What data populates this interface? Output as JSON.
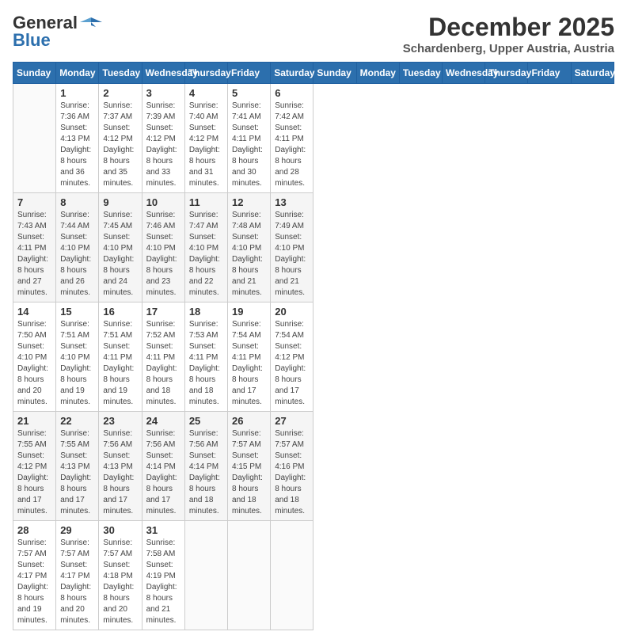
{
  "header": {
    "logo_general": "General",
    "logo_blue": "Blue",
    "month_title": "December 2025",
    "subtitle": "Schardenberg, Upper Austria, Austria"
  },
  "calendar": {
    "days_of_week": [
      "Sunday",
      "Monday",
      "Tuesday",
      "Wednesday",
      "Thursday",
      "Friday",
      "Saturday"
    ],
    "weeks": [
      [
        {
          "day": "",
          "sunrise": "",
          "sunset": "",
          "daylight": ""
        },
        {
          "day": "1",
          "sunrise": "Sunrise: 7:36 AM",
          "sunset": "Sunset: 4:13 PM",
          "daylight": "Daylight: 8 hours and 36 minutes."
        },
        {
          "day": "2",
          "sunrise": "Sunrise: 7:37 AM",
          "sunset": "Sunset: 4:12 PM",
          "daylight": "Daylight: 8 hours and 35 minutes."
        },
        {
          "day": "3",
          "sunrise": "Sunrise: 7:39 AM",
          "sunset": "Sunset: 4:12 PM",
          "daylight": "Daylight: 8 hours and 33 minutes."
        },
        {
          "day": "4",
          "sunrise": "Sunrise: 7:40 AM",
          "sunset": "Sunset: 4:12 PM",
          "daylight": "Daylight: 8 hours and 31 minutes."
        },
        {
          "day": "5",
          "sunrise": "Sunrise: 7:41 AM",
          "sunset": "Sunset: 4:11 PM",
          "daylight": "Daylight: 8 hours and 30 minutes."
        },
        {
          "day": "6",
          "sunrise": "Sunrise: 7:42 AM",
          "sunset": "Sunset: 4:11 PM",
          "daylight": "Daylight: 8 hours and 28 minutes."
        }
      ],
      [
        {
          "day": "7",
          "sunrise": "Sunrise: 7:43 AM",
          "sunset": "Sunset: 4:11 PM",
          "daylight": "Daylight: 8 hours and 27 minutes."
        },
        {
          "day": "8",
          "sunrise": "Sunrise: 7:44 AM",
          "sunset": "Sunset: 4:10 PM",
          "daylight": "Daylight: 8 hours and 26 minutes."
        },
        {
          "day": "9",
          "sunrise": "Sunrise: 7:45 AM",
          "sunset": "Sunset: 4:10 PM",
          "daylight": "Daylight: 8 hours and 24 minutes."
        },
        {
          "day": "10",
          "sunrise": "Sunrise: 7:46 AM",
          "sunset": "Sunset: 4:10 PM",
          "daylight": "Daylight: 8 hours and 23 minutes."
        },
        {
          "day": "11",
          "sunrise": "Sunrise: 7:47 AM",
          "sunset": "Sunset: 4:10 PM",
          "daylight": "Daylight: 8 hours and 22 minutes."
        },
        {
          "day": "12",
          "sunrise": "Sunrise: 7:48 AM",
          "sunset": "Sunset: 4:10 PM",
          "daylight": "Daylight: 8 hours and 21 minutes."
        },
        {
          "day": "13",
          "sunrise": "Sunrise: 7:49 AM",
          "sunset": "Sunset: 4:10 PM",
          "daylight": "Daylight: 8 hours and 21 minutes."
        }
      ],
      [
        {
          "day": "14",
          "sunrise": "Sunrise: 7:50 AM",
          "sunset": "Sunset: 4:10 PM",
          "daylight": "Daylight: 8 hours and 20 minutes."
        },
        {
          "day": "15",
          "sunrise": "Sunrise: 7:51 AM",
          "sunset": "Sunset: 4:10 PM",
          "daylight": "Daylight: 8 hours and 19 minutes."
        },
        {
          "day": "16",
          "sunrise": "Sunrise: 7:51 AM",
          "sunset": "Sunset: 4:11 PM",
          "daylight": "Daylight: 8 hours and 19 minutes."
        },
        {
          "day": "17",
          "sunrise": "Sunrise: 7:52 AM",
          "sunset": "Sunset: 4:11 PM",
          "daylight": "Daylight: 8 hours and 18 minutes."
        },
        {
          "day": "18",
          "sunrise": "Sunrise: 7:53 AM",
          "sunset": "Sunset: 4:11 PM",
          "daylight": "Daylight: 8 hours and 18 minutes."
        },
        {
          "day": "19",
          "sunrise": "Sunrise: 7:54 AM",
          "sunset": "Sunset: 4:11 PM",
          "daylight": "Daylight: 8 hours and 17 minutes."
        },
        {
          "day": "20",
          "sunrise": "Sunrise: 7:54 AM",
          "sunset": "Sunset: 4:12 PM",
          "daylight": "Daylight: 8 hours and 17 minutes."
        }
      ],
      [
        {
          "day": "21",
          "sunrise": "Sunrise: 7:55 AM",
          "sunset": "Sunset: 4:12 PM",
          "daylight": "Daylight: 8 hours and 17 minutes."
        },
        {
          "day": "22",
          "sunrise": "Sunrise: 7:55 AM",
          "sunset": "Sunset: 4:13 PM",
          "daylight": "Daylight: 8 hours and 17 minutes."
        },
        {
          "day": "23",
          "sunrise": "Sunrise: 7:56 AM",
          "sunset": "Sunset: 4:13 PM",
          "daylight": "Daylight: 8 hours and 17 minutes."
        },
        {
          "day": "24",
          "sunrise": "Sunrise: 7:56 AM",
          "sunset": "Sunset: 4:14 PM",
          "daylight": "Daylight: 8 hours and 17 minutes."
        },
        {
          "day": "25",
          "sunrise": "Sunrise: 7:56 AM",
          "sunset": "Sunset: 4:14 PM",
          "daylight": "Daylight: 8 hours and 18 minutes."
        },
        {
          "day": "26",
          "sunrise": "Sunrise: 7:57 AM",
          "sunset": "Sunset: 4:15 PM",
          "daylight": "Daylight: 8 hours and 18 minutes."
        },
        {
          "day": "27",
          "sunrise": "Sunrise: 7:57 AM",
          "sunset": "Sunset: 4:16 PM",
          "daylight": "Daylight: 8 hours and 18 minutes."
        }
      ],
      [
        {
          "day": "28",
          "sunrise": "Sunrise: 7:57 AM",
          "sunset": "Sunset: 4:17 PM",
          "daylight": "Daylight: 8 hours and 19 minutes."
        },
        {
          "day": "29",
          "sunrise": "Sunrise: 7:57 AM",
          "sunset": "Sunset: 4:17 PM",
          "daylight": "Daylight: 8 hours and 20 minutes."
        },
        {
          "day": "30",
          "sunrise": "Sunrise: 7:57 AM",
          "sunset": "Sunset: 4:18 PM",
          "daylight": "Daylight: 8 hours and 20 minutes."
        },
        {
          "day": "31",
          "sunrise": "Sunrise: 7:58 AM",
          "sunset": "Sunset: 4:19 PM",
          "daylight": "Daylight: 8 hours and 21 minutes."
        },
        {
          "day": "",
          "sunrise": "",
          "sunset": "",
          "daylight": ""
        },
        {
          "day": "",
          "sunrise": "",
          "sunset": "",
          "daylight": ""
        },
        {
          "day": "",
          "sunrise": "",
          "sunset": "",
          "daylight": ""
        }
      ]
    ]
  }
}
